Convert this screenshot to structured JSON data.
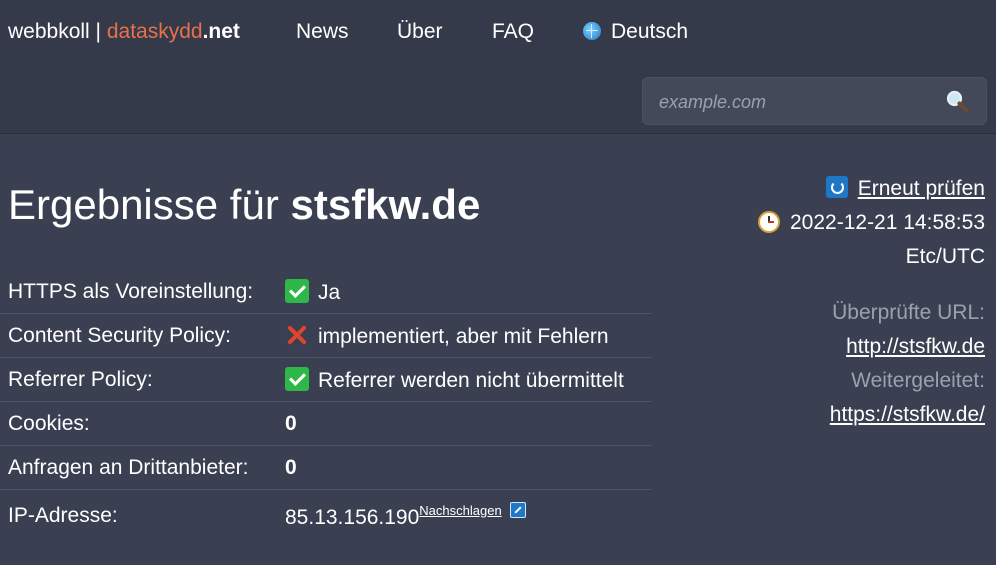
{
  "header": {
    "brand": {
      "part1": "webbkoll",
      "sep": " | ",
      "part2": "dataskydd",
      "part3": ".net"
    },
    "nav": [
      {
        "label": "News"
      },
      {
        "label": "Über"
      },
      {
        "label": "FAQ"
      },
      {
        "label": "Deutsch",
        "icon": "globe-icon"
      }
    ],
    "search": {
      "placeholder": "example.com",
      "value": "",
      "icon": "magnifier-icon"
    }
  },
  "main": {
    "title_prefix": "Ergebnisse für",
    "domain": "stsfkw.de",
    "rows": [
      {
        "key": "HTTPS als Voreinstellung:",
        "status": "ok",
        "value": "Ja"
      },
      {
        "key": "Content Security Policy:",
        "status": "error",
        "value": "implementiert, aber mit Fehlern"
      },
      {
        "key": "Referrer Policy:",
        "status": "ok",
        "value": "Referrer werden nicht übermittelt"
      },
      {
        "key": "Cookies:",
        "status": "none",
        "value": "0"
      },
      {
        "key": "Anfragen an Drittanbieter:",
        "status": "none",
        "value": "0"
      },
      {
        "key": "IP-Adresse:",
        "status": "none",
        "value": "85.13.156.190",
        "link": "Nachschlagen"
      }
    ]
  },
  "side": {
    "recheck_label": "Erneut prüfen",
    "date": "2022-12-21 14:58:53",
    "timezone": "Etc/UTC",
    "checked_url_label": "Überprüfte URL:",
    "checked_url": "http://stsfkw.de",
    "redirected_label": "Weitergeleitet:",
    "redirected_url": "https://stsfkw.de/"
  },
  "colors": {
    "background": "#3a3f51",
    "header": "#353a4a",
    "accent": "#e8704a",
    "ok": "#2fb84a",
    "error": "#e0452c",
    "link_icon": "#1f78c7"
  }
}
